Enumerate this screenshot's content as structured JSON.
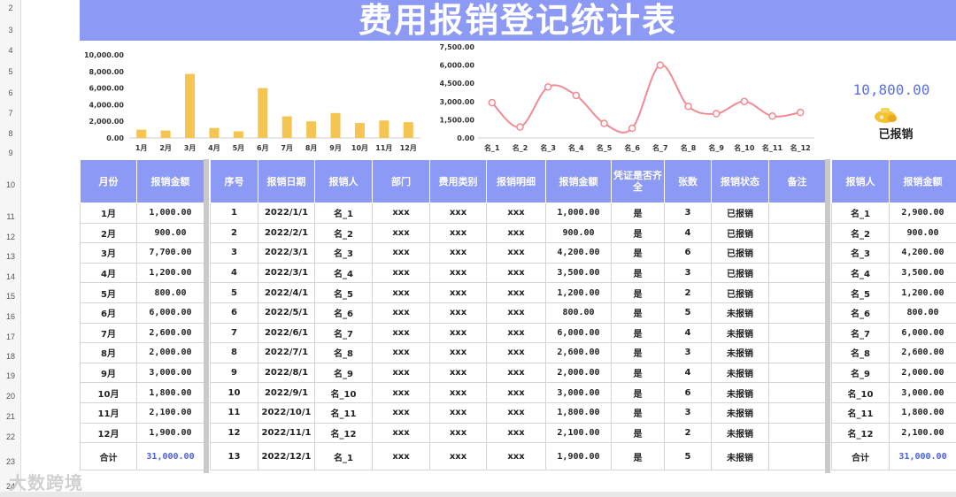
{
  "row_numbers": [
    "2",
    "3",
    "4",
    "5",
    "6",
    "7",
    "8",
    "9",
    "10",
    "11",
    "12",
    "13",
    "14",
    "15",
    "16",
    "17",
    "18",
    "19",
    "20",
    "21",
    "22",
    "23",
    "24"
  ],
  "title": "费用报销登记统计表",
  "colors": {
    "accent": "#8c99f5",
    "bar": "#f5c451",
    "line": "#f28a93",
    "total_blue": "#4a5fe0"
  },
  "chart_data": [
    {
      "type": "bar",
      "categories": [
        "1月",
        "2月",
        "3月",
        "4月",
        "5月",
        "6月",
        "7月",
        "8月",
        "9月",
        "10月",
        "11月",
        "12月"
      ],
      "values": [
        1000,
        900,
        7700,
        1200,
        800,
        6000,
        2600,
        2000,
        3000,
        1800,
        2100,
        1900
      ],
      "ylim": [
        0,
        10000
      ],
      "ytick_labels": [
        "0.00",
        "2,000.00",
        "4,000.00",
        "6,000.00",
        "8,000.00",
        "10,000.00"
      ],
      "title": "",
      "xlabel": "",
      "ylabel": "",
      "grid": false
    },
    {
      "type": "line",
      "categories": [
        "名_1",
        "名_2",
        "名_3",
        "名_4",
        "名_5",
        "名_6",
        "名_7",
        "名_8",
        "名_9",
        "名_10",
        "名_11",
        "名_12"
      ],
      "values": [
        2900,
        900,
        4200,
        3500,
        1200,
        800,
        6000,
        2600,
        2000,
        3000,
        1800,
        2100
      ],
      "ylim": [
        0,
        7500
      ],
      "ytick_labels": [
        "0.00",
        "1,500.00",
        "3,000.00",
        "4,500.00",
        "6,000.00",
        "7,500.00"
      ],
      "title": "",
      "xlabel": "",
      "ylabel": "",
      "grid": false
    }
  ],
  "summary": {
    "total_amount": "10,800.00",
    "status": "已报销",
    "icon": "money-bag-icon"
  },
  "monthly": {
    "headers": [
      "月份",
      "报销金额"
    ],
    "rows": [
      [
        "1月",
        "1,000.00"
      ],
      [
        "2月",
        "900.00"
      ],
      [
        "3月",
        "7,700.00"
      ],
      [
        "4月",
        "1,200.00"
      ],
      [
        "5月",
        "800.00"
      ],
      [
        "6月",
        "6,000.00"
      ],
      [
        "7月",
        "2,600.00"
      ],
      [
        "8月",
        "2,000.00"
      ],
      [
        "9月",
        "3,000.00"
      ],
      [
        "10月",
        "1,800.00"
      ],
      [
        "11月",
        "2,100.00"
      ],
      [
        "12月",
        "1,900.00"
      ]
    ],
    "total_label": "合计",
    "total_value": "31,000.00"
  },
  "records": {
    "headers": [
      "序号",
      "报销日期",
      "报销人",
      "部门",
      "费用类别",
      "报销明细",
      "报销金额",
      "凭证是否齐全",
      "张数",
      "报销状态",
      "备注"
    ],
    "rows": [
      [
        "1",
        "2022/1/1",
        "名_1",
        "xxx",
        "xxx",
        "xxx",
        "1,000.00",
        "是",
        "3",
        "已报销",
        ""
      ],
      [
        "2",
        "2022/2/1",
        "名_2",
        "xxx",
        "xxx",
        "xxx",
        "900.00",
        "是",
        "4",
        "已报销",
        ""
      ],
      [
        "3",
        "2022/3/1",
        "名_3",
        "xxx",
        "xxx",
        "xxx",
        "4,200.00",
        "是",
        "6",
        "已报销",
        ""
      ],
      [
        "4",
        "2022/3/1",
        "名_4",
        "xxx",
        "xxx",
        "xxx",
        "3,500.00",
        "是",
        "3",
        "已报销",
        ""
      ],
      [
        "5",
        "2022/4/1",
        "名_5",
        "xxx",
        "xxx",
        "xxx",
        "1,200.00",
        "是",
        "2",
        "已报销",
        ""
      ],
      [
        "6",
        "2022/5/1",
        "名_6",
        "xxx",
        "xxx",
        "xxx",
        "800.00",
        "是",
        "5",
        "未报销",
        ""
      ],
      [
        "7",
        "2022/6/1",
        "名_7",
        "xxx",
        "xxx",
        "xxx",
        "6,000.00",
        "是",
        "4",
        "未报销",
        ""
      ],
      [
        "8",
        "2022/7/1",
        "名_8",
        "xxx",
        "xxx",
        "xxx",
        "2,600.00",
        "是",
        "3",
        "未报销",
        ""
      ],
      [
        "9",
        "2022/8/1",
        "名_9",
        "xxx",
        "xxx",
        "xxx",
        "2,000.00",
        "是",
        "4",
        "未报销",
        ""
      ],
      [
        "10",
        "2022/9/1",
        "名_10",
        "xxx",
        "xxx",
        "xxx",
        "3,000.00",
        "是",
        "6",
        "未报销",
        ""
      ],
      [
        "11",
        "2022/10/1",
        "名_11",
        "xxx",
        "xxx",
        "xxx",
        "1,800.00",
        "是",
        "3",
        "未报销",
        ""
      ],
      [
        "12",
        "2022/11/1",
        "名_12",
        "xxx",
        "xxx",
        "xxx",
        "2,100.00",
        "是",
        "2",
        "未报销",
        ""
      ],
      [
        "13",
        "2022/12/1",
        "名_1",
        "xxx",
        "xxx",
        "xxx",
        "1,900.00",
        "是",
        "5",
        "未报销",
        ""
      ]
    ]
  },
  "persons": {
    "headers": [
      "报销人",
      "报销金额"
    ],
    "rows": [
      [
        "名_1",
        "2,900.00"
      ],
      [
        "名_2",
        "900.00"
      ],
      [
        "名_3",
        "4,200.00"
      ],
      [
        "名_4",
        "3,500.00"
      ],
      [
        "名_5",
        "1,200.00"
      ],
      [
        "名_6",
        "800.00"
      ],
      [
        "名_7",
        "6,000.00"
      ],
      [
        "名_8",
        "2,600.00"
      ],
      [
        "名_9",
        "2,000.00"
      ],
      [
        "名_10",
        "3,000.00"
      ],
      [
        "名_11",
        "1,800.00"
      ],
      [
        "名_12",
        "2,100.00"
      ]
    ],
    "total_label": "合计",
    "total_value": "31,000.00"
  },
  "watermark": "大数跨境"
}
